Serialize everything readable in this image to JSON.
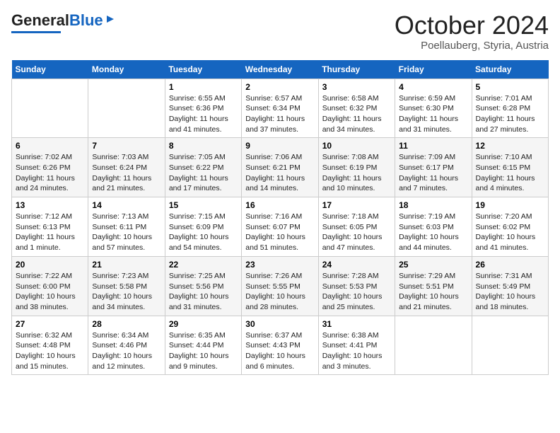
{
  "header": {
    "logo_general": "General",
    "logo_blue": "Blue",
    "month": "October 2024",
    "location": "Poellauberg, Styria, Austria"
  },
  "days_of_week": [
    "Sunday",
    "Monday",
    "Tuesday",
    "Wednesday",
    "Thursday",
    "Friday",
    "Saturday"
  ],
  "weeks": [
    [
      {
        "day": "",
        "info": ""
      },
      {
        "day": "",
        "info": ""
      },
      {
        "day": "1",
        "info": "Sunrise: 6:55 AM\nSunset: 6:36 PM\nDaylight: 11 hours and 41 minutes."
      },
      {
        "day": "2",
        "info": "Sunrise: 6:57 AM\nSunset: 6:34 PM\nDaylight: 11 hours and 37 minutes."
      },
      {
        "day": "3",
        "info": "Sunrise: 6:58 AM\nSunset: 6:32 PM\nDaylight: 11 hours and 34 minutes."
      },
      {
        "day": "4",
        "info": "Sunrise: 6:59 AM\nSunset: 6:30 PM\nDaylight: 11 hours and 31 minutes."
      },
      {
        "day": "5",
        "info": "Sunrise: 7:01 AM\nSunset: 6:28 PM\nDaylight: 11 hours and 27 minutes."
      }
    ],
    [
      {
        "day": "6",
        "info": "Sunrise: 7:02 AM\nSunset: 6:26 PM\nDaylight: 11 hours and 24 minutes."
      },
      {
        "day": "7",
        "info": "Sunrise: 7:03 AM\nSunset: 6:24 PM\nDaylight: 11 hours and 21 minutes."
      },
      {
        "day": "8",
        "info": "Sunrise: 7:05 AM\nSunset: 6:22 PM\nDaylight: 11 hours and 17 minutes."
      },
      {
        "day": "9",
        "info": "Sunrise: 7:06 AM\nSunset: 6:21 PM\nDaylight: 11 hours and 14 minutes."
      },
      {
        "day": "10",
        "info": "Sunrise: 7:08 AM\nSunset: 6:19 PM\nDaylight: 11 hours and 10 minutes."
      },
      {
        "day": "11",
        "info": "Sunrise: 7:09 AM\nSunset: 6:17 PM\nDaylight: 11 hours and 7 minutes."
      },
      {
        "day": "12",
        "info": "Sunrise: 7:10 AM\nSunset: 6:15 PM\nDaylight: 11 hours and 4 minutes."
      }
    ],
    [
      {
        "day": "13",
        "info": "Sunrise: 7:12 AM\nSunset: 6:13 PM\nDaylight: 11 hours and 1 minute."
      },
      {
        "day": "14",
        "info": "Sunrise: 7:13 AM\nSunset: 6:11 PM\nDaylight: 10 hours and 57 minutes."
      },
      {
        "day": "15",
        "info": "Sunrise: 7:15 AM\nSunset: 6:09 PM\nDaylight: 10 hours and 54 minutes."
      },
      {
        "day": "16",
        "info": "Sunrise: 7:16 AM\nSunset: 6:07 PM\nDaylight: 10 hours and 51 minutes."
      },
      {
        "day": "17",
        "info": "Sunrise: 7:18 AM\nSunset: 6:05 PM\nDaylight: 10 hours and 47 minutes."
      },
      {
        "day": "18",
        "info": "Sunrise: 7:19 AM\nSunset: 6:03 PM\nDaylight: 10 hours and 44 minutes."
      },
      {
        "day": "19",
        "info": "Sunrise: 7:20 AM\nSunset: 6:02 PM\nDaylight: 10 hours and 41 minutes."
      }
    ],
    [
      {
        "day": "20",
        "info": "Sunrise: 7:22 AM\nSunset: 6:00 PM\nDaylight: 10 hours and 38 minutes."
      },
      {
        "day": "21",
        "info": "Sunrise: 7:23 AM\nSunset: 5:58 PM\nDaylight: 10 hours and 34 minutes."
      },
      {
        "day": "22",
        "info": "Sunrise: 7:25 AM\nSunset: 5:56 PM\nDaylight: 10 hours and 31 minutes."
      },
      {
        "day": "23",
        "info": "Sunrise: 7:26 AM\nSunset: 5:55 PM\nDaylight: 10 hours and 28 minutes."
      },
      {
        "day": "24",
        "info": "Sunrise: 7:28 AM\nSunset: 5:53 PM\nDaylight: 10 hours and 25 minutes."
      },
      {
        "day": "25",
        "info": "Sunrise: 7:29 AM\nSunset: 5:51 PM\nDaylight: 10 hours and 21 minutes."
      },
      {
        "day": "26",
        "info": "Sunrise: 7:31 AM\nSunset: 5:49 PM\nDaylight: 10 hours and 18 minutes."
      }
    ],
    [
      {
        "day": "27",
        "info": "Sunrise: 6:32 AM\nSunset: 4:48 PM\nDaylight: 10 hours and 15 minutes."
      },
      {
        "day": "28",
        "info": "Sunrise: 6:34 AM\nSunset: 4:46 PM\nDaylight: 10 hours and 12 minutes."
      },
      {
        "day": "29",
        "info": "Sunrise: 6:35 AM\nSunset: 4:44 PM\nDaylight: 10 hours and 9 minutes."
      },
      {
        "day": "30",
        "info": "Sunrise: 6:37 AM\nSunset: 4:43 PM\nDaylight: 10 hours and 6 minutes."
      },
      {
        "day": "31",
        "info": "Sunrise: 6:38 AM\nSunset: 4:41 PM\nDaylight: 10 hours and 3 minutes."
      },
      {
        "day": "",
        "info": ""
      },
      {
        "day": "",
        "info": ""
      }
    ]
  ]
}
